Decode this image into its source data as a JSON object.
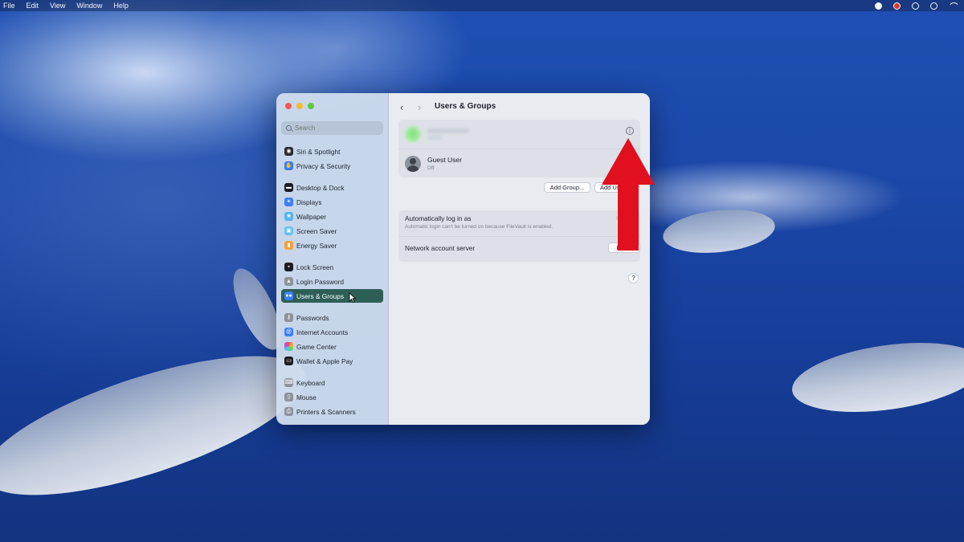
{
  "menubar": {
    "items": [
      "File",
      "Edit",
      "View",
      "Window",
      "Help"
    ],
    "tray_icons": [
      "record-icon",
      "screen-share-icon",
      "play-icon",
      "info-icon",
      "wifi-icon"
    ]
  },
  "window": {
    "title": "Users & Groups",
    "search_placeholder": "Search",
    "sidebar": {
      "items": [
        {
          "label": "Siri & Spotlight",
          "icon": "siri-icon",
          "color": "#2b2b33",
          "selected": false
        },
        {
          "label": "Privacy & Security",
          "icon": "hand-icon",
          "color": "#3a7ef5",
          "selected": false
        },
        {
          "label": "Desktop & Dock",
          "icon": "dock-icon",
          "color": "#1c1c22",
          "selected": false
        },
        {
          "label": "Displays",
          "icon": "display-icon",
          "color": "#3a7ef5",
          "selected": false
        },
        {
          "label": "Wallpaper",
          "icon": "wallpaper-icon",
          "color": "#52b6ef",
          "selected": false
        },
        {
          "label": "Screen Saver",
          "icon": "screen-saver-icon",
          "color": "#63c2ee",
          "selected": false
        },
        {
          "label": "Energy Saver",
          "icon": "battery-icon",
          "color": "#f3a23b",
          "selected": false
        },
        {
          "label": "Lock Screen",
          "icon": "lock-screen-icon",
          "color": "#1c1c22",
          "selected": false
        },
        {
          "label": "Login Password",
          "icon": "lock-icon",
          "color": "#8d939d",
          "selected": false
        },
        {
          "label": "Users & Groups",
          "icon": "users-icon",
          "color": "#3a7ef5",
          "selected": true
        },
        {
          "label": "Passwords",
          "icon": "key-icon",
          "color": "#8d939d",
          "selected": false
        },
        {
          "label": "Internet Accounts",
          "icon": "at-icon",
          "color": "#3a7ef5",
          "selected": false
        },
        {
          "label": "Game Center",
          "icon": "game-center-icon",
          "color": "#e9e9ee",
          "selected": false
        },
        {
          "label": "Wallet & Apple Pay",
          "icon": "wallet-icon",
          "color": "#1c1c22",
          "selected": false
        },
        {
          "label": "Keyboard",
          "icon": "keyboard-icon",
          "color": "#8d939d",
          "selected": false
        },
        {
          "label": "Mouse",
          "icon": "mouse-icon",
          "color": "#8d939d",
          "selected": false
        },
        {
          "label": "Printers & Scanners",
          "icon": "printer-icon",
          "color": "#8d939d",
          "selected": false
        }
      ]
    },
    "users": {
      "guest": {
        "name": "Guest User",
        "status": "Off"
      },
      "add_group_label": "Add Group...",
      "add_user_label": "Add User..."
    },
    "login": {
      "auto_login_title": "Automatically log in as",
      "auto_login_note": "Automatic login can't be turned on because FileVault is enabled.",
      "auto_login_value": "Off",
      "network_server_title": "Network account server",
      "edit_label": "Edit..."
    },
    "help_label": "?"
  },
  "annotation": {
    "arrow_color": "#e0101e"
  }
}
